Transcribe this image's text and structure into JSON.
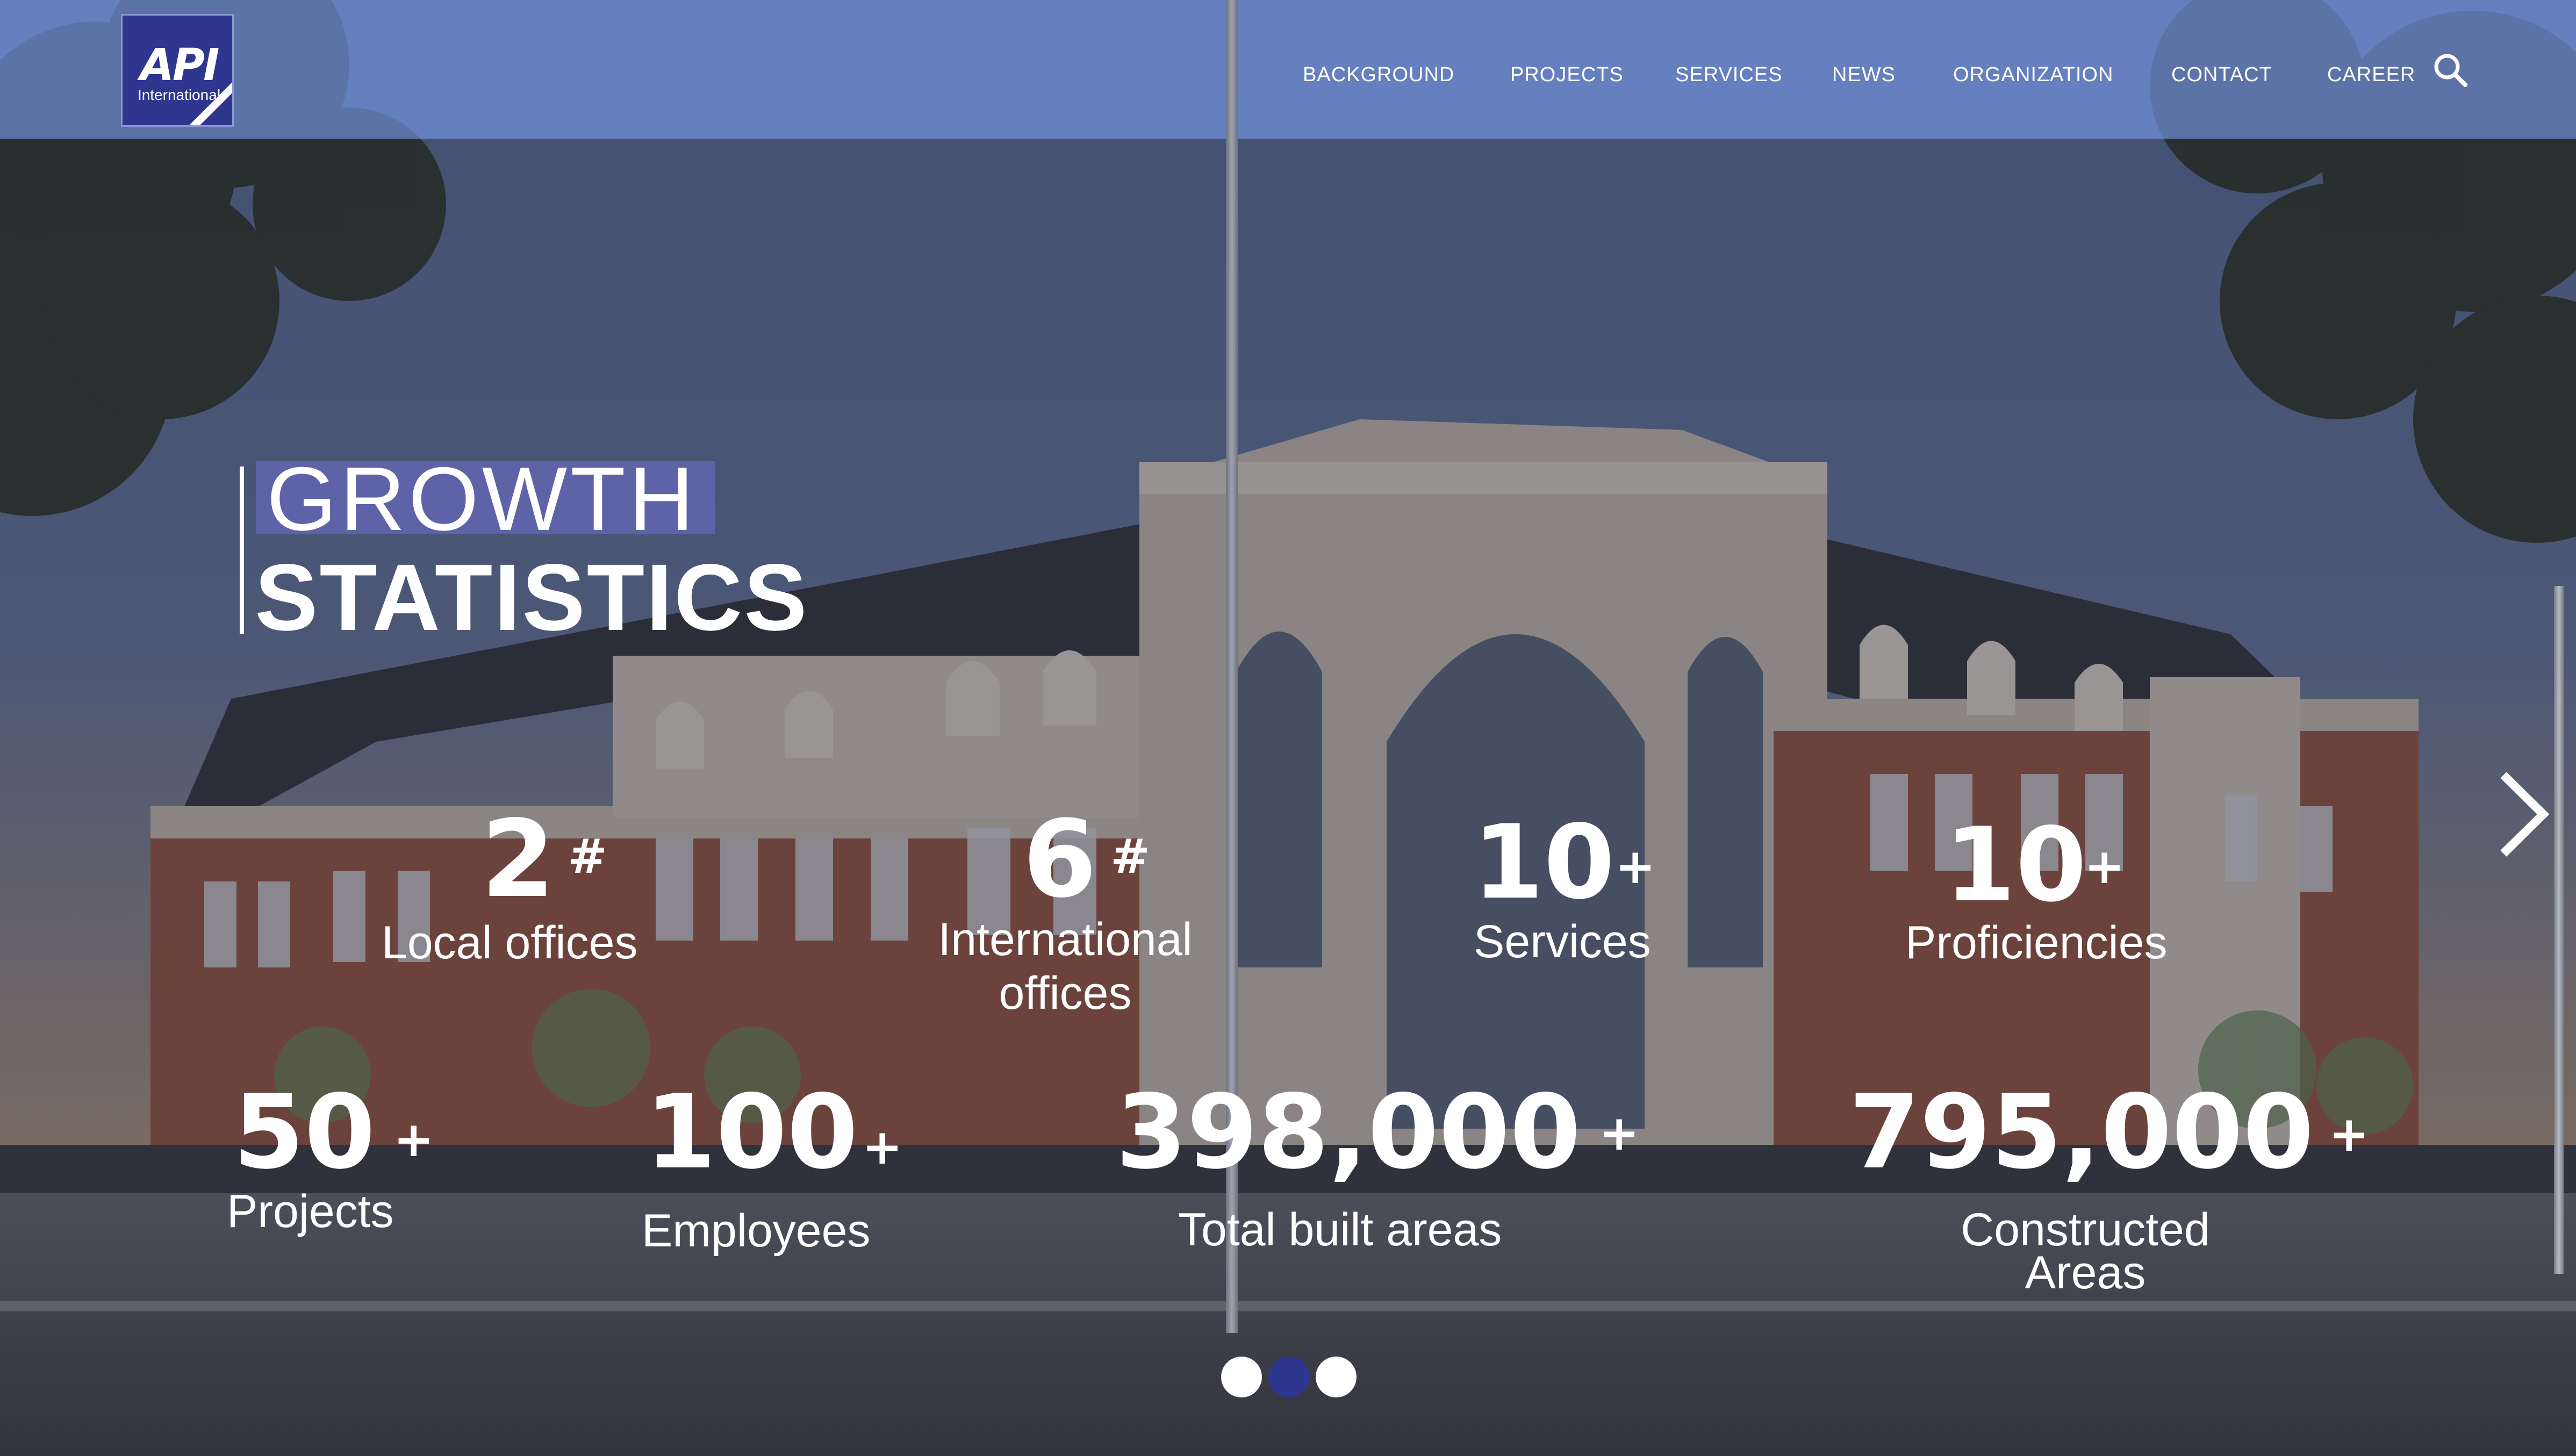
{
  "header": {
    "logo": {
      "text": "API",
      "subtext": "International"
    },
    "nav": [
      {
        "label": "BACKGROUND"
      },
      {
        "label": "PROJECTS"
      },
      {
        "label": "SERVICES"
      },
      {
        "label": "NEWS"
      },
      {
        "label": "ORGANIZATION"
      },
      {
        "label": "CONTACT"
      },
      {
        "label": "CAREER"
      }
    ],
    "search_icon": "search-icon"
  },
  "heading": {
    "line1": "GROWTH",
    "line2": "STATISTICS",
    "accent_color": "#5e63a8"
  },
  "stats": [
    {
      "value": "2",
      "suffix": "#",
      "label": "Local offices"
    },
    {
      "value": "6",
      "suffix": "#",
      "label": "International offices",
      "label_lines": [
        "International",
        "offices"
      ]
    },
    {
      "value": "10",
      "suffix": "+",
      "label": "Services"
    },
    {
      "value": "10",
      "suffix": "+",
      "label": "Proficiencies"
    },
    {
      "value": "50",
      "suffix": "+",
      "label": "Projects"
    },
    {
      "value": "100",
      "suffix": "+",
      "label": "Employees"
    },
    {
      "value": "398,000",
      "suffix": "+",
      "label": "Total built areas"
    },
    {
      "value": "795,000",
      "suffix": "+",
      "label": "Constructed Areas",
      "label_lines": [
        "Constructed",
        "Areas"
      ]
    }
  ],
  "slider": {
    "next_icon": "chevron-right-icon",
    "dots": [
      {
        "active": false
      },
      {
        "active": true
      },
      {
        "active": false
      }
    ],
    "active_dot_color": "#2f3690",
    "inactive_dot_color": "#ffffff"
  },
  "colors": {
    "header_band": "#6884c8",
    "brand": "#2f3690"
  }
}
